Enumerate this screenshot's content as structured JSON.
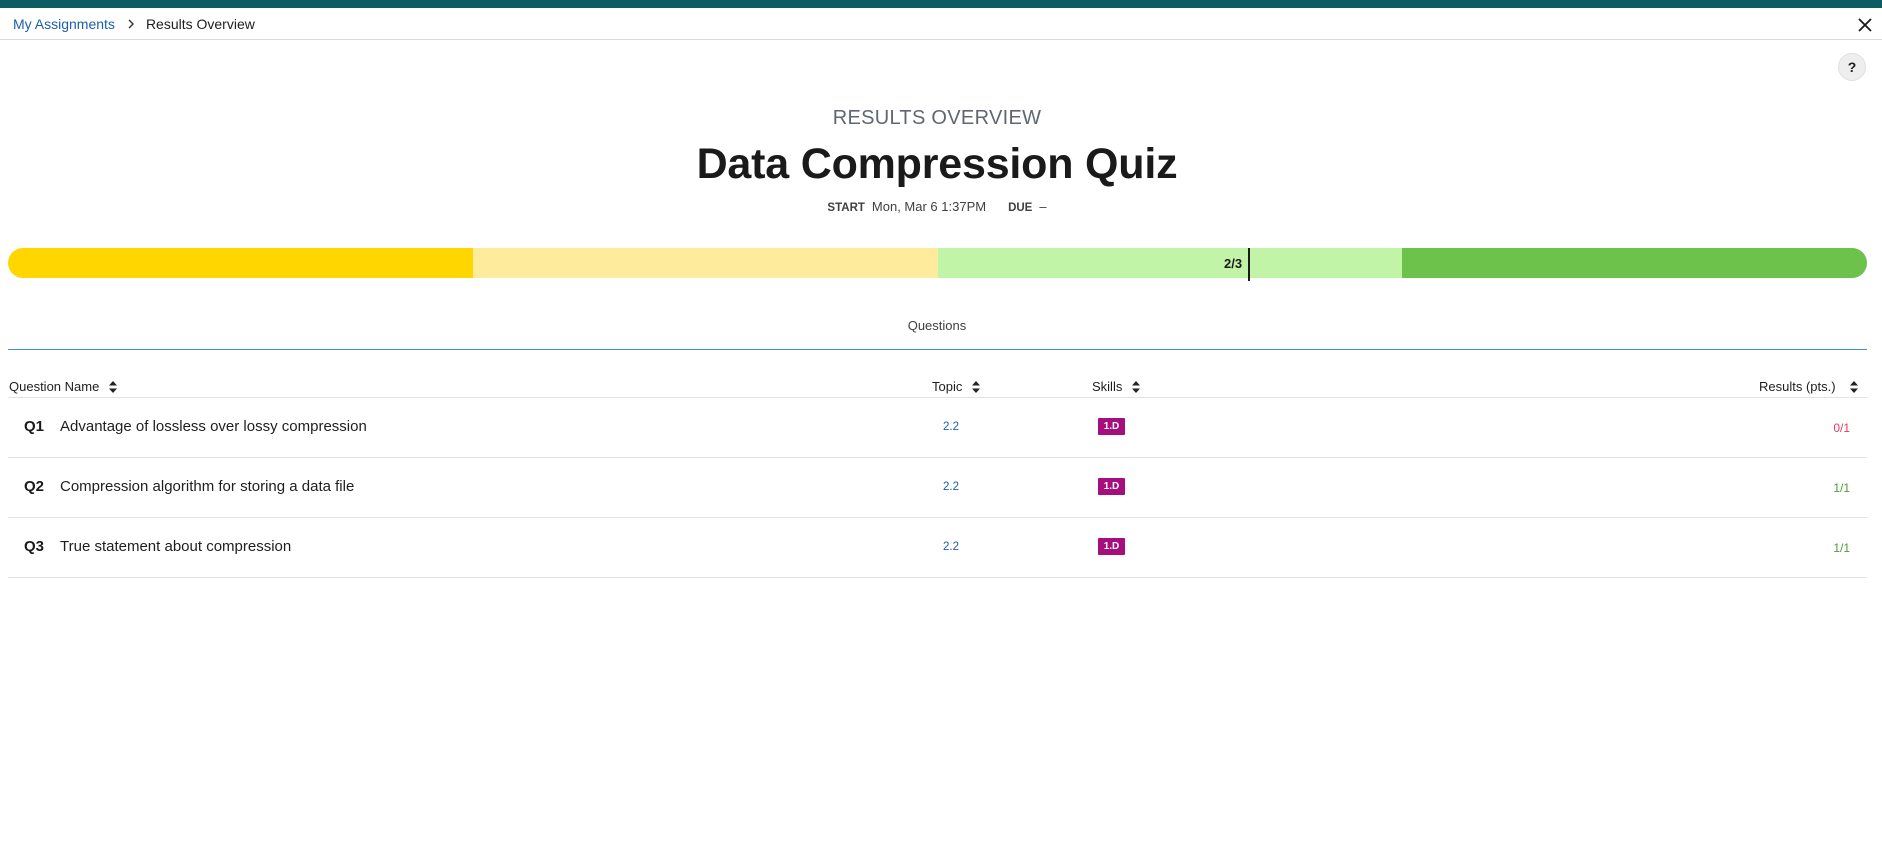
{
  "breadcrumb": {
    "parent": "My Assignments",
    "separator_icon": "chevron-right-icon",
    "current": "Results Overview"
  },
  "header": {
    "close_icon": "close-icon",
    "help_label": "?"
  },
  "overview": {
    "eyebrow": "RESULTS OVERVIEW",
    "title": "Data Compression Quiz",
    "start_label": "START",
    "start_value": "Mon, Mar 6 1:37PM",
    "due_label": "DUE",
    "due_value": "–"
  },
  "score_bar": {
    "label": "2/3",
    "score_fraction": 0.667,
    "segment_colors": [
      "#ffd600",
      "#ffeb9c",
      "#c2f4a8",
      "#6cc24a"
    ]
  },
  "tabs": {
    "active": "Questions"
  },
  "table": {
    "columns": {
      "name": "Question Name",
      "topic": "Topic",
      "skills": "Skills",
      "results": "Results (pts.)"
    },
    "sort_icon": "sort-arrows-icon",
    "rows": [
      {
        "num": "Q1",
        "name": "Advantage of lossless over lossy compression",
        "topic": "2.2",
        "skill": "1.D",
        "result": "0/1",
        "status": "incorrect"
      },
      {
        "num": "Q2",
        "name": "Compression algorithm for storing a data file",
        "topic": "2.2",
        "skill": "1.D",
        "result": "1/1",
        "status": "correct"
      },
      {
        "num": "Q3",
        "name": "True statement about compression",
        "topic": "2.2",
        "skill": "1.D",
        "result": "1/1",
        "status": "correct"
      }
    ]
  },
  "colors": {
    "brand_strip": "#0b5c63",
    "link": "#1d5fa8",
    "skill_badge": "#a50e7c",
    "result_incorrect": "#e0405d",
    "result_correct": "#4a9e2e",
    "tab_underline": "#3d90d8"
  }
}
